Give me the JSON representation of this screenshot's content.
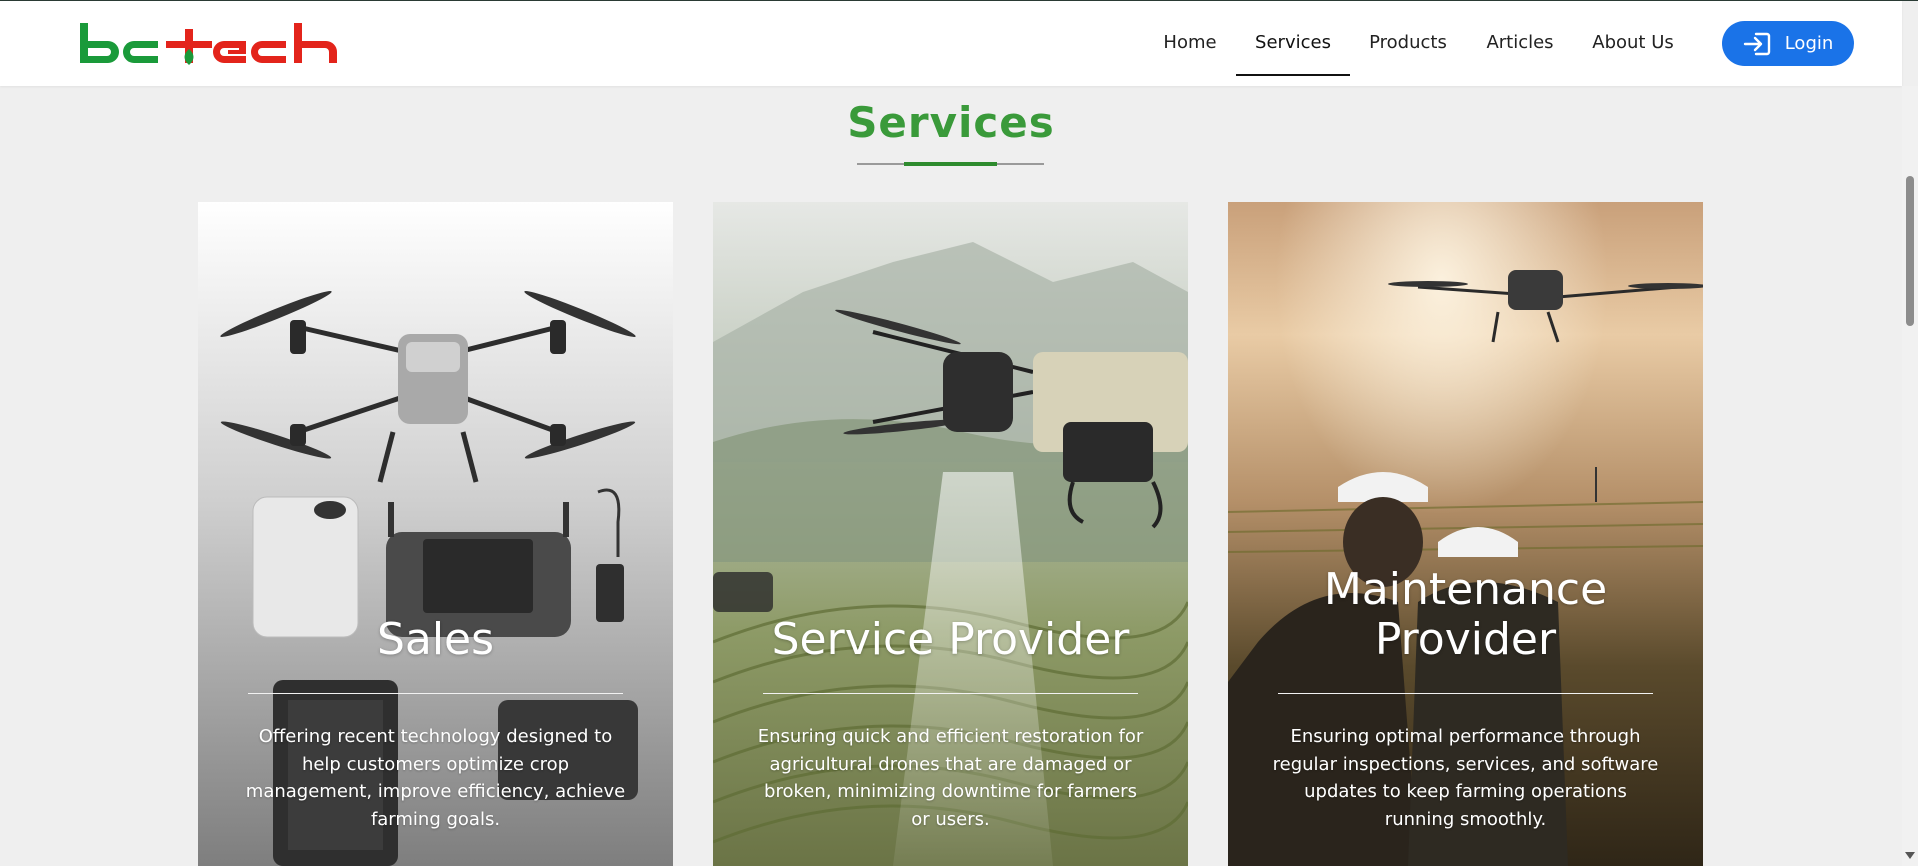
{
  "header": {
    "logo_text": "bctech",
    "nav": [
      {
        "label": "Home",
        "active": false
      },
      {
        "label": "Services",
        "active": true
      },
      {
        "label": "Products",
        "active": false
      },
      {
        "label": "Articles",
        "active": false
      },
      {
        "label": "About Us",
        "active": false
      }
    ],
    "login_label": "Login",
    "login_icon": "login-icon"
  },
  "section": {
    "title": "Services"
  },
  "cards": [
    {
      "title": "Sales",
      "description": "Offering recent technology designed to help customers optimize crop management, improve efficiency, achieve farming goals."
    },
    {
      "title": "Service Provider",
      "description": "Ensuring quick and efficient restoration for agricultural drones that are damaged or broken, minimizing downtime for farmers or users."
    },
    {
      "title": "Maintenance Provider",
      "description": "Ensuring optimal performance through regular inspections, services, and software updates to keep farming operations running smoothly."
    }
  ],
  "colors": {
    "brand_green": "#1a9a3a",
    "brand_red": "#e3241b",
    "title_green": "#3a9a3a",
    "login_blue": "#1a73e8",
    "page_bg": "#efefef"
  }
}
